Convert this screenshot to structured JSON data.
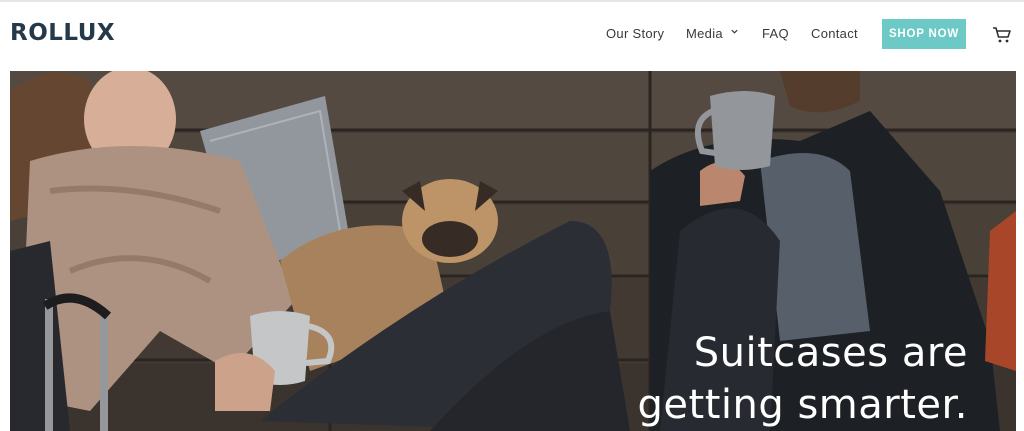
{
  "brand": {
    "logo": "ROLLUX"
  },
  "nav": {
    "items": [
      {
        "label": "Our Story"
      },
      {
        "label": "Media",
        "has_dropdown": true
      },
      {
        "label": "FAQ"
      },
      {
        "label": "Contact"
      }
    ],
    "cta": "SHOP NOW",
    "cart_icon": "cart-icon"
  },
  "hero": {
    "headline_line1": "Suitcases are",
    "headline_line2": "getting smarter."
  },
  "colors": {
    "brand_dark": "#24394a",
    "accent": "#6cc9c6",
    "headline": "#ffffff"
  }
}
